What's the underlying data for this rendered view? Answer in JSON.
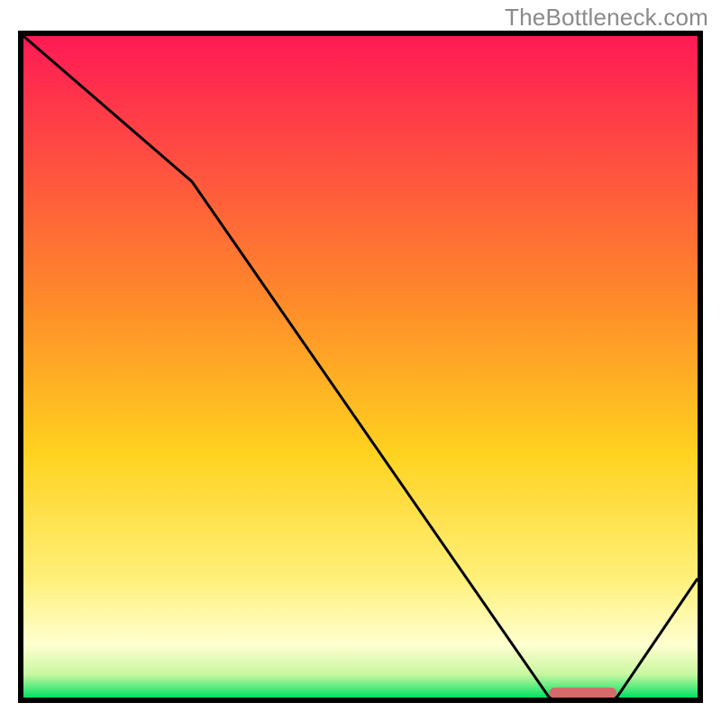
{
  "watermark": "TheBottleneck.com",
  "chart_data": {
    "type": "line",
    "title": "",
    "xlabel": "",
    "ylabel": "",
    "xlim": [
      0,
      100
    ],
    "ylim": [
      0,
      100
    ],
    "x": [
      0,
      25,
      78,
      88,
      100
    ],
    "y": [
      100,
      78,
      0,
      0,
      18
    ],
    "marker": {
      "x": [
        78,
        88
      ],
      "y": [
        0.7,
        0.7
      ]
    },
    "gradient_stops": [
      {
        "offset": 0,
        "color": "#ff1a55"
      },
      {
        "offset": 0.4,
        "color": "#ff8a2a"
      },
      {
        "offset": 0.63,
        "color": "#ffd21f"
      },
      {
        "offset": 0.82,
        "color": "#fff07a"
      },
      {
        "offset": 0.92,
        "color": "#ffffd0"
      },
      {
        "offset": 0.965,
        "color": "#c8f7a0"
      },
      {
        "offset": 1.0,
        "color": "#00e263"
      }
    ],
    "line_color": "#000000",
    "marker_color": "#d46a6a"
  }
}
